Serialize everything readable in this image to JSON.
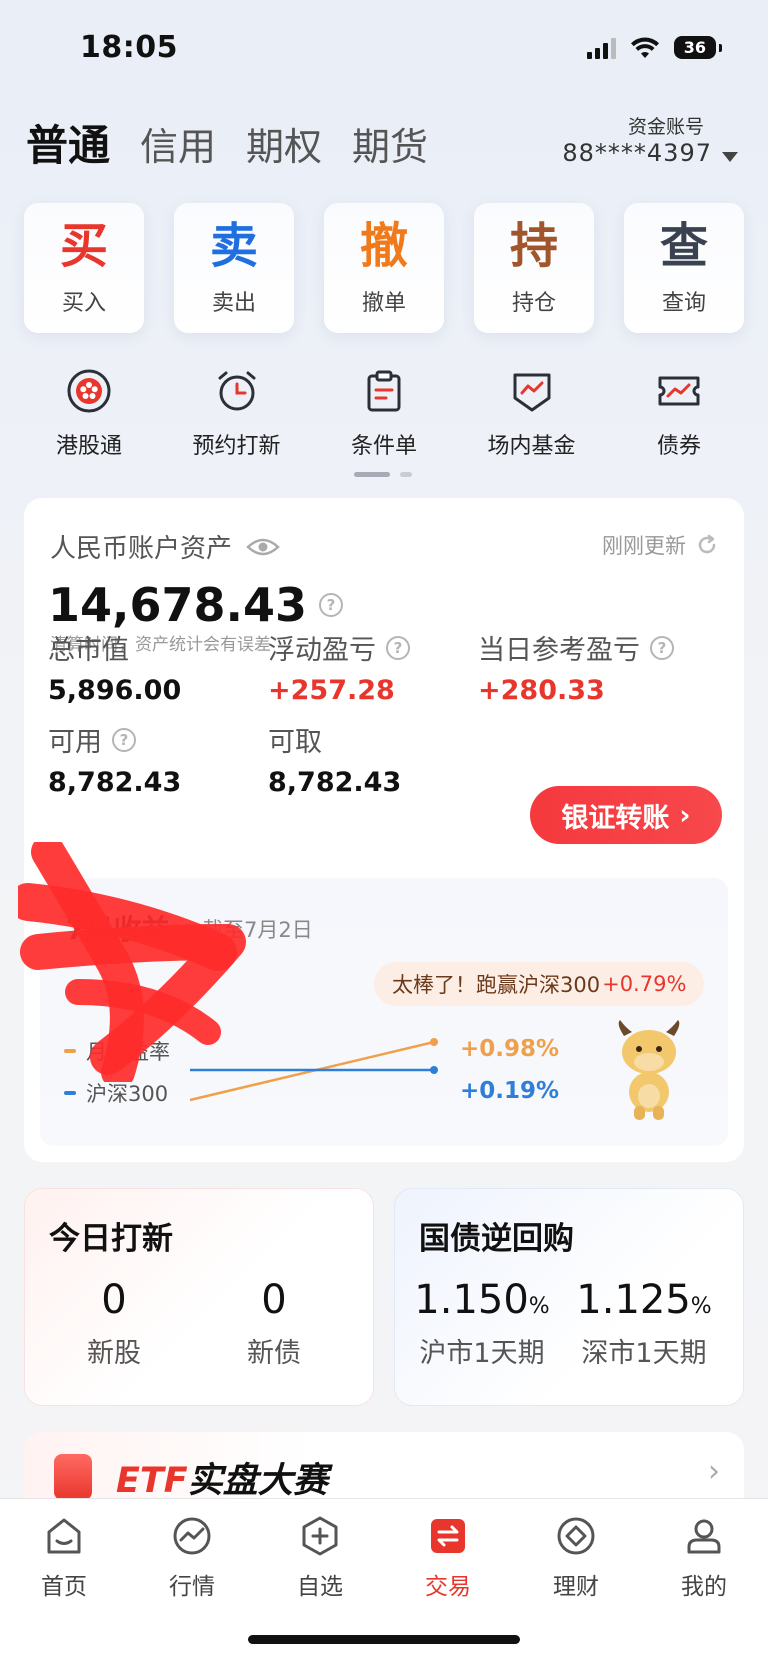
{
  "status": {
    "time": "18:05",
    "battery": "36"
  },
  "tabs": [
    "普通",
    "信用",
    "期权",
    "期货"
  ],
  "account": {
    "label": "资金账号",
    "number": "88****4397"
  },
  "actions": [
    {
      "glyph": "买",
      "label": "买入",
      "color": "#e8362d"
    },
    {
      "glyph": "卖",
      "label": "卖出",
      "color": "#1f6fe0"
    },
    {
      "glyph": "撤",
      "label": "撤单",
      "color": "#f07a1a"
    },
    {
      "glyph": "持",
      "label": "持仓",
      "color": "#a0552b"
    },
    {
      "glyph": "查",
      "label": "查询",
      "color": "#3a4252"
    }
  ],
  "services": [
    {
      "label": "港股通",
      "icon": "bauhinia-icon"
    },
    {
      "label": "预约打新",
      "icon": "alarm-clock-icon"
    },
    {
      "label": "条件单",
      "icon": "clipboard-icon"
    },
    {
      "label": "场内基金",
      "icon": "shield-chart-icon"
    },
    {
      "label": "债券",
      "icon": "ticket-chart-icon"
    }
  ],
  "asset": {
    "title": "人民币账户资产",
    "update_text": "刚刚更新",
    "total": "14,678.43",
    "note": "清算时间，资产统计会有误差",
    "market_value_label": "总市值",
    "market_value": "5,896.00",
    "floating_pl_label": "浮动盈亏",
    "floating_pl": "+257.28",
    "daily_pl_label": "当日参考盈亏",
    "daily_pl": "+280.33",
    "available_label": "可用",
    "available": "8,782.43",
    "withdrawable_label": "可取",
    "withdrawable": "8,782.43",
    "transfer_button": "银证转账"
  },
  "earnings": {
    "title": "7月收益",
    "as_of": "截至7月2日",
    "bubble": "太棒了！跑赢沪深300",
    "bubble_value": "+0.79%",
    "legend_return": "月收益率",
    "legend_index": "沪深300",
    "return_value": "+0.98%",
    "index_value": "+0.19%",
    "colors": {
      "return": "#f0a04b",
      "index": "#2f7fd8"
    }
  },
  "ipo": {
    "title": "今日打新",
    "stocks_count": "0",
    "stocks_label": "新股",
    "bonds_count": "0",
    "bonds_label": "新债"
  },
  "repo": {
    "title": "国债逆回购",
    "sh_rate": "1.150",
    "sh_label": "沪市1天期",
    "sz_rate": "1.125",
    "sz_label": "深市1天期",
    "unit": "%"
  },
  "etf": {
    "prefix": "ETF",
    "text": "实盘大赛"
  },
  "nav": [
    {
      "label": "首页",
      "icon": "home-icon"
    },
    {
      "label": "行情",
      "icon": "market-icon"
    },
    {
      "label": "自选",
      "icon": "watchlist-icon"
    },
    {
      "label": "交易",
      "icon": "trade-icon",
      "active": true
    },
    {
      "label": "理财",
      "icon": "wealth-icon"
    },
    {
      "label": "我的",
      "icon": "profile-icon"
    }
  ],
  "accent": "#e8362d"
}
